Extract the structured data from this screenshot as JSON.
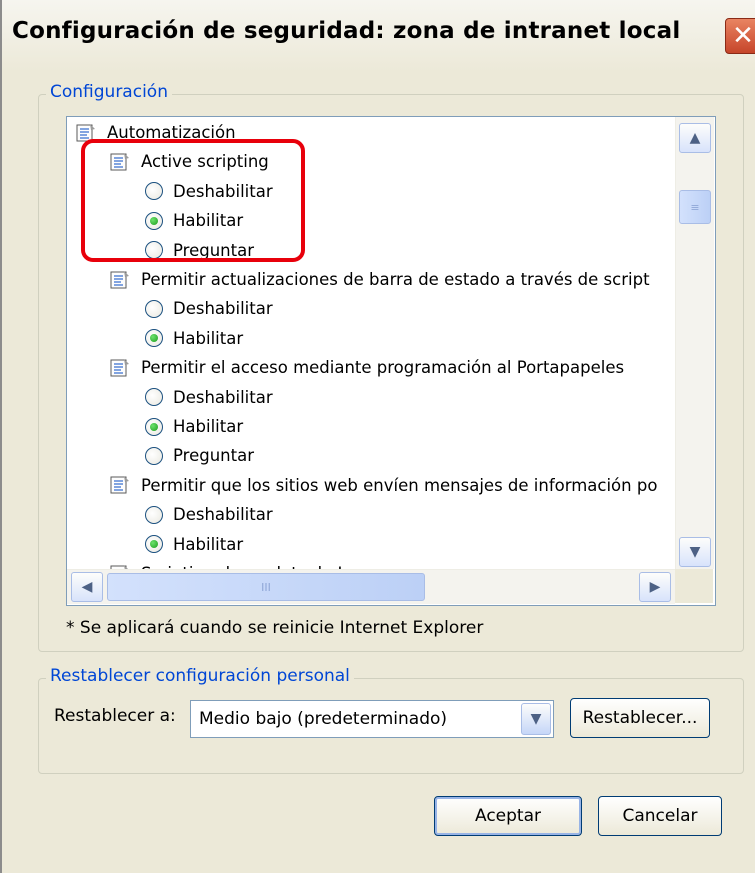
{
  "window": {
    "title": "Configuración de seguridad: zona de intranet local",
    "close_glyph": "✕"
  },
  "settings_group": {
    "legend": "Configuración",
    "items": [
      {
        "kind": "category",
        "label": "Automatización"
      },
      {
        "kind": "setting",
        "label": "Active scripting"
      },
      {
        "kind": "option",
        "label": "Deshabilitar",
        "checked": false
      },
      {
        "kind": "option",
        "label": "Habilitar",
        "checked": true
      },
      {
        "kind": "option",
        "label": "Preguntar",
        "checked": false
      },
      {
        "kind": "setting",
        "label": "Permitir actualizaciones de barra de estado a través de script"
      },
      {
        "kind": "option",
        "label": "Deshabilitar",
        "checked": false
      },
      {
        "kind": "option",
        "label": "Habilitar",
        "checked": true
      },
      {
        "kind": "setting",
        "label": "Permitir el acceso mediante programación al Portapapeles"
      },
      {
        "kind": "option",
        "label": "Deshabilitar",
        "checked": false
      },
      {
        "kind": "option",
        "label": "Habilitar",
        "checked": true
      },
      {
        "kind": "option",
        "label": "Preguntar",
        "checked": false
      },
      {
        "kind": "setting",
        "label": "Permitir que los sitios web envíen mensajes de información po"
      },
      {
        "kind": "option",
        "label": "Deshabilitar",
        "checked": false
      },
      {
        "kind": "option",
        "label": "Habilitar",
        "checked": true
      },
      {
        "kind": "setting",
        "label": "Scripting de applets de Java"
      }
    ],
    "note": "* Se aplicará cuando se reinicie Internet Explorer"
  },
  "scrollbars": {
    "up_glyph": "▲",
    "down_glyph": "▼",
    "left_glyph": "◀",
    "right_glyph": "▶",
    "vgrip": "≡",
    "hgrip": "III"
  },
  "reset_group": {
    "legend": "Restablecer configuración personal",
    "reset_to_label": "Restablecer a:",
    "selected_level": "Medio bajo (predeterminado)",
    "reset_button": "Restablecer..."
  },
  "buttons": {
    "ok": "Aceptar",
    "cancel": "Cancelar"
  },
  "colors": {
    "highlight": "#e8000b",
    "legend": "#0046d5",
    "radio_checked": "#1e9e1e"
  }
}
